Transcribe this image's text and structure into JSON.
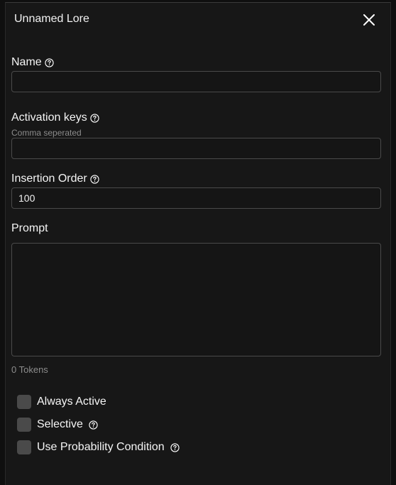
{
  "header": {
    "title": "Unnamed Lore",
    "close_icon": "close-icon"
  },
  "form": {
    "name": {
      "label": "Name",
      "value": "",
      "placeholder": ""
    },
    "activation_keys": {
      "label": "Activation keys",
      "hint": "Comma seperated",
      "value": "",
      "placeholder": ""
    },
    "insertion_order": {
      "label": "Insertion Order",
      "value": "100"
    },
    "prompt": {
      "label": "Prompt",
      "value": "",
      "tokens_text": "0 Tokens"
    }
  },
  "options": {
    "always_active": {
      "label": "Always Active",
      "checked": false
    },
    "selective": {
      "label": "Selective",
      "checked": false
    },
    "use_probability": {
      "label": "Use Probability Condition",
      "checked": false
    }
  },
  "colors": {
    "panel_bg": "#171717",
    "page_bg": "#0f0f0f",
    "border": "#4a4a4a",
    "muted_text": "#8c8c8c",
    "checkbox_bg": "#4a4a4a"
  }
}
